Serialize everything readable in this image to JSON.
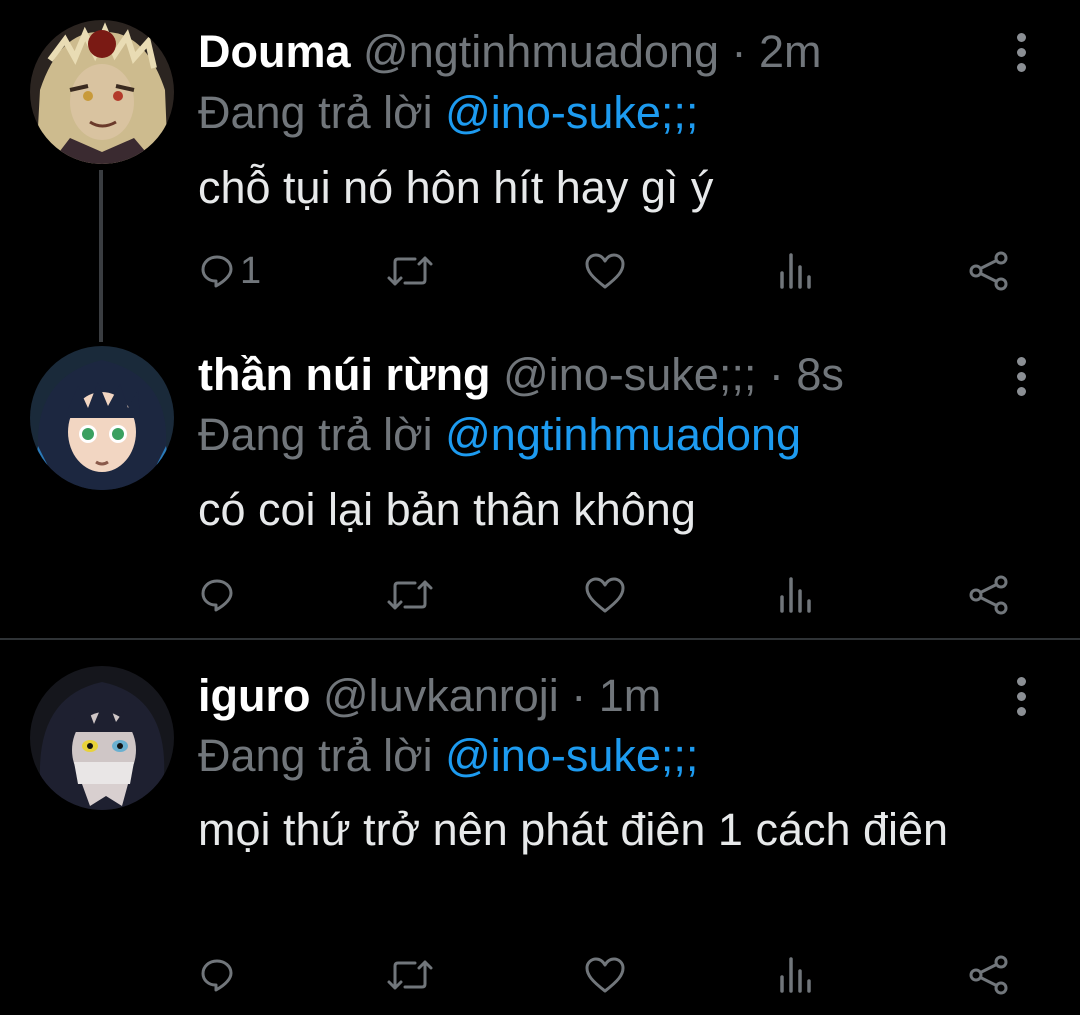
{
  "colors": {
    "background": "#000000",
    "name": "#ffffff",
    "secondary": "#71767b",
    "mention": "#1d9bf0",
    "divider": "#2f3336"
  },
  "tweets": [
    {
      "name": "Douma",
      "handle": "@ngtinhmuadong",
      "separator": "·",
      "time": "2m",
      "reply_prefix": "Đang trả lời",
      "reply_to": "@ino-suke;;;",
      "text": "chỗ tụi nó hôn hít hay gì ý",
      "reply_count": "1",
      "avatar_icon": "avatar-douma"
    },
    {
      "name": "thần núi rừng",
      "handle": "@ino-suke;;;",
      "separator": "·",
      "time": "8s",
      "reply_prefix": "Đang trả lời",
      "reply_to": "@ngtinhmuadong",
      "text": "có coi lại bản thân không",
      "reply_count": "",
      "avatar_icon": "avatar-inosuke"
    },
    {
      "name": "iguro",
      "handle": "@luvkanroji",
      "separator": "·",
      "time": "1m",
      "reply_prefix": "Đang trả lời",
      "reply_to": "@ino-suke;;;",
      "text": "mọi thứ trở nên phát điên 1 cách điên",
      "reply_count": "",
      "avatar_icon": "avatar-iguro"
    }
  ],
  "action_icons": [
    "reply-icon",
    "retweet-icon",
    "like-icon",
    "views-icon",
    "share-icon"
  ]
}
